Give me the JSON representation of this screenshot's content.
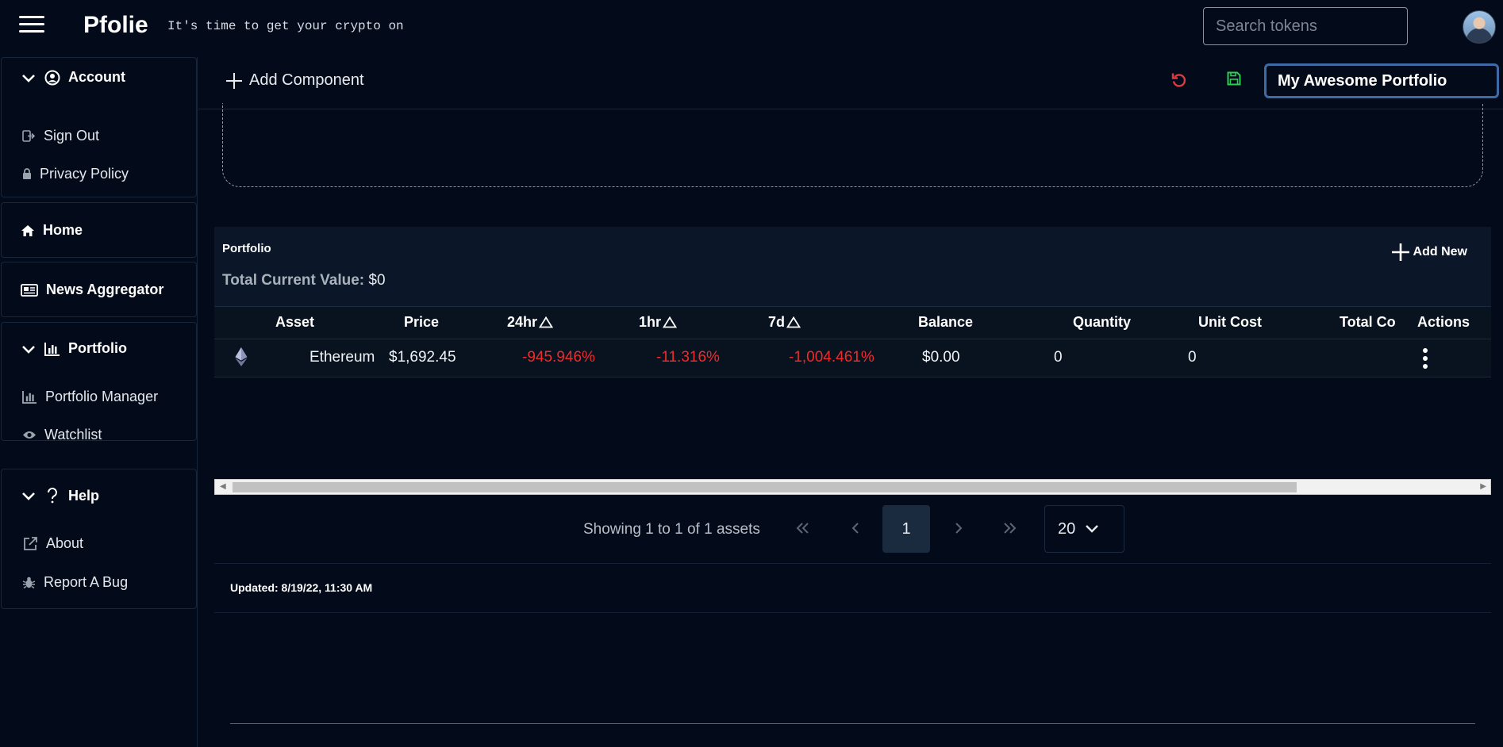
{
  "app": {
    "brand": "Pfolie",
    "tagline": "It's time to get your crypto on"
  },
  "search": {
    "placeholder": "Search tokens"
  },
  "sidebar": {
    "account": {
      "label": "Account",
      "items": [
        "Sign Out",
        "Privacy Policy"
      ]
    },
    "home": {
      "label": "Home"
    },
    "news": {
      "label": "News Aggregator"
    },
    "portfolio": {
      "label": "Portfolio",
      "items": [
        "Portfolio Manager",
        "Watchlist"
      ]
    },
    "help": {
      "label": "Help",
      "items": [
        "About",
        "Report A Bug"
      ]
    }
  },
  "toolbar": {
    "add_component": "Add Component",
    "portfolio_name": "My Awesome Portfolio"
  },
  "portfolio": {
    "title": "Portfolio",
    "total_label": "Total Current Value:",
    "total_value": "$0",
    "add_new": "Add New",
    "columns": [
      "Asset",
      "Price",
      "24hr",
      "1hr",
      "7d",
      "Balance",
      "Quantity",
      "Unit Cost",
      "Total Co:",
      "Actions"
    ],
    "rows": [
      {
        "asset": "Ethereum",
        "price": "$1,692.45",
        "change_24h": "-945.946%",
        "change_1h": "-11.316%",
        "change_7d": "-1,004.461%",
        "balance": "$0.00",
        "quantity": "0",
        "unit_cost": "0"
      }
    ]
  },
  "pagination": {
    "summary": "Showing 1 to 1 of 1 assets",
    "current_page": "1",
    "page_size": "20"
  },
  "updated": "Updated: 8/19/22, 11:30 AM",
  "colors": {
    "background": "#030b1a",
    "card": "#0b1728",
    "negative": "#ee2b2b",
    "undo": "#e0393e",
    "save": "#2ecc52",
    "input_focus": "#3e6aa6"
  }
}
